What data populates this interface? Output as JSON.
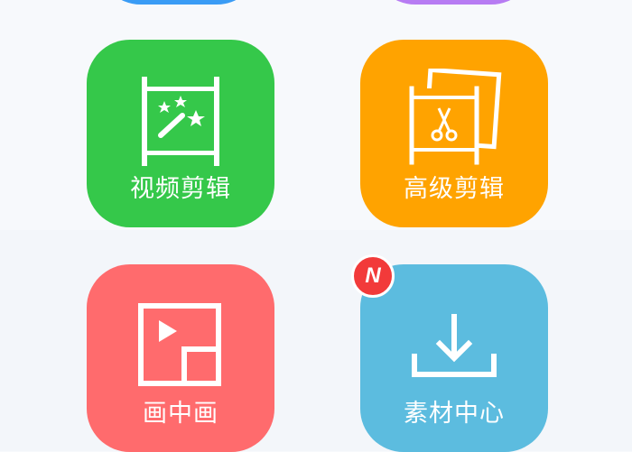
{
  "colors": {
    "page_bg": "#f7f9fc",
    "top_left_partial": "#3a9cf5",
    "top_right_partial": "#b77cf3",
    "video_edit": "#35c84a",
    "advanced_edit": "#ffa300",
    "picture_in_picture": "#ff6b6d",
    "material_center": "#5cbcdf",
    "badge": "#f23a3a"
  },
  "tiles": {
    "video_edit": {
      "label": "视频剪辑",
      "icon": "magic-wand-film-icon"
    },
    "advanced_edit": {
      "label": "高级剪辑",
      "icon": "scissors-film-icon"
    },
    "picture_in_picture": {
      "label": "画中画",
      "icon": "picture-in-picture-icon"
    },
    "material_center": {
      "label": "素材中心",
      "icon": "download-tray-icon",
      "badge": "N"
    }
  }
}
